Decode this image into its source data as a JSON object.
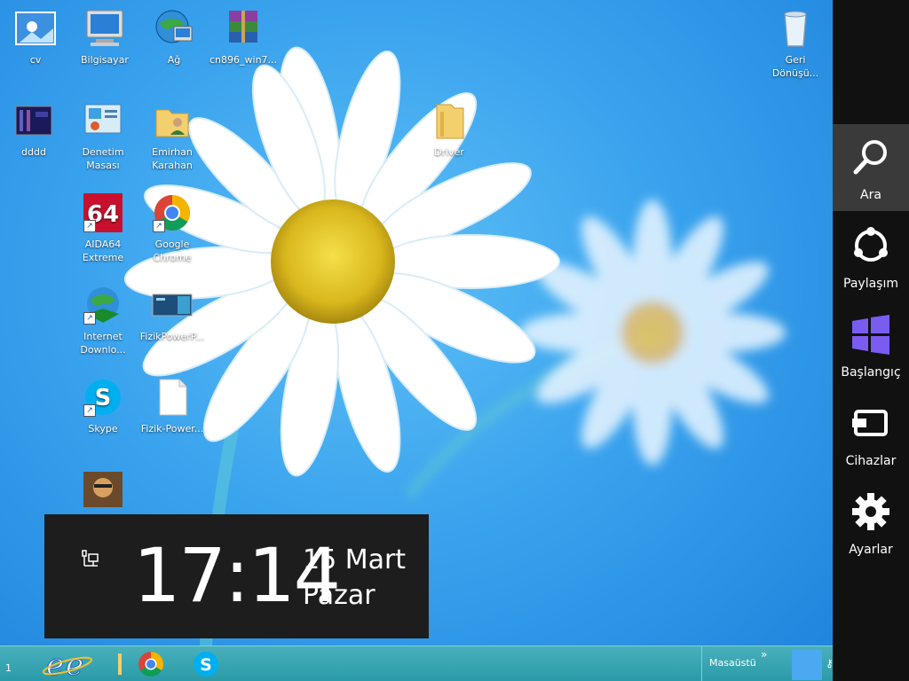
{
  "desktop": {
    "icons": [
      {
        "label": "cv"
      },
      {
        "label": "Bilgisayar"
      },
      {
        "label": "Ağ"
      },
      {
        "label": "cn896_win7..."
      },
      {
        "label": "Geri Dönüşü..."
      },
      {
        "label": "dddd"
      },
      {
        "label": "Denetim Masası"
      },
      {
        "label": "Emirhan Karahan"
      },
      {
        "label": "Driver"
      },
      {
        "label": "AIDA64 Extreme"
      },
      {
        "label": "Google Chrome"
      },
      {
        "label": "Internet Downlo..."
      },
      {
        "label": "FizikPowerP..."
      },
      {
        "label": "Skype"
      },
      {
        "label": "Fizik-Power..."
      }
    ]
  },
  "clock": {
    "time": "17:14",
    "date": "15 Mart",
    "day": "Pazar"
  },
  "taskbar": {
    "desktop_label": "Masaüstü",
    "chevron": "»",
    "left_fragment": "1"
  },
  "charms": [
    {
      "label": "Ara",
      "icon": "search-icon"
    },
    {
      "label": "Paylaşım",
      "icon": "share-icon"
    },
    {
      "label": "Başlangıç",
      "icon": "windows-start-icon"
    },
    {
      "label": "Cihazlar",
      "icon": "devices-icon"
    },
    {
      "label": "Ayarlar",
      "icon": "settings-gear-icon"
    }
  ],
  "colors": {
    "desktop": "#3aa3ee",
    "charms_bar": "#111111",
    "taskbar": "#2a9aa8",
    "clock_panel": "#1d1d1d"
  }
}
